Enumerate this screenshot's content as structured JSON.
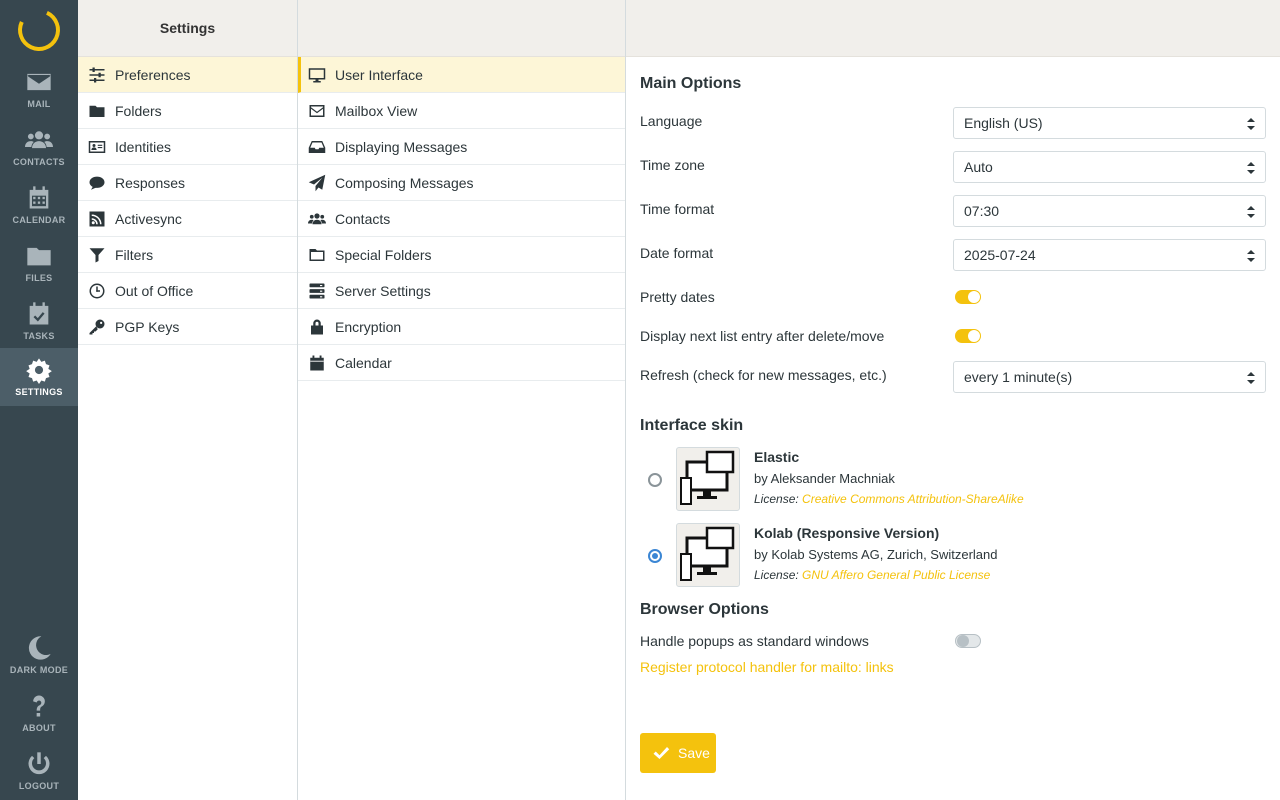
{
  "rail": {
    "items": [
      {
        "label": "MAIL",
        "icon": "mail-icon"
      },
      {
        "label": "CONTACTS",
        "icon": "contacts-icon"
      },
      {
        "label": "CALENDAR",
        "icon": "calendar-icon"
      },
      {
        "label": "FILES",
        "icon": "files-icon"
      },
      {
        "label": "TASKS",
        "icon": "tasks-icon"
      },
      {
        "label": "SETTINGS",
        "icon": "settings-icon"
      }
    ],
    "bottom": [
      {
        "label": "DARK MODE",
        "icon": "moon-icon"
      },
      {
        "label": "ABOUT",
        "icon": "question-icon"
      },
      {
        "label": "LOGOUT",
        "icon": "power-icon"
      }
    ]
  },
  "settings": {
    "title": "Settings",
    "items": [
      {
        "label": "Preferences",
        "icon": "sliders-icon"
      },
      {
        "label": "Folders",
        "icon": "folder-icon"
      },
      {
        "label": "Identities",
        "icon": "id-card-icon"
      },
      {
        "label": "Responses",
        "icon": "comment-icon"
      },
      {
        "label": "Activesync",
        "icon": "rss-icon"
      },
      {
        "label": "Filters",
        "icon": "filter-icon"
      },
      {
        "label": "Out of Office",
        "icon": "clock-icon"
      },
      {
        "label": "PGP Keys",
        "icon": "key-icon"
      }
    ]
  },
  "sections": {
    "items": [
      {
        "label": "User Interface",
        "icon": "monitor-icon"
      },
      {
        "label": "Mailbox View",
        "icon": "envelope-icon"
      },
      {
        "label": "Displaying Messages",
        "icon": "inbox-icon"
      },
      {
        "label": "Composing Messages",
        "icon": "paper-plane-icon"
      },
      {
        "label": "Contacts",
        "icon": "users-icon"
      },
      {
        "label": "Special Folders",
        "icon": "folder-outline-icon"
      },
      {
        "label": "Server Settings",
        "icon": "server-icon"
      },
      {
        "label": "Encryption",
        "icon": "lock-icon"
      },
      {
        "label": "Calendar",
        "icon": "calendar-icon"
      }
    ]
  },
  "main": {
    "main_options_title": "Main Options",
    "language": {
      "label": "Language",
      "value": "English (US)"
    },
    "timezone": {
      "label": "Time zone",
      "value": "Auto"
    },
    "time_format": {
      "label": "Time format",
      "value": "07:30"
    },
    "date_format": {
      "label": "Date format",
      "value": "2025-07-24"
    },
    "pretty_dates": {
      "label": "Pretty dates",
      "on": true
    },
    "next_entry": {
      "label": "Display next list entry after delete/move",
      "on": true
    },
    "refresh": {
      "label": "Refresh (check for new messages, etc.)",
      "value": "every 1 minute(s)"
    },
    "skin_title": "Interface skin",
    "skins": [
      {
        "name": "Elastic",
        "author": "by Aleksander Machniak",
        "license_label": "License:",
        "license": "Creative Commons Attribution-ShareAlike",
        "selected": false
      },
      {
        "name": "Kolab (Responsive Version)",
        "author": "by Kolab Systems AG, Zurich, Switzerland",
        "license_label": "License:",
        "license": "GNU Affero General Public License",
        "selected": true
      }
    ],
    "browser_title": "Browser Options",
    "popups": {
      "label": "Handle popups as standard windows",
      "on": false
    },
    "protocol_link": "Register protocol handler for mailto: links",
    "save_label": "Save"
  },
  "colors": {
    "accent": "#f4c20d",
    "rail_bg": "#37474f",
    "selected_bg": "#fdf6d7",
    "radio": "#3b86d4"
  }
}
